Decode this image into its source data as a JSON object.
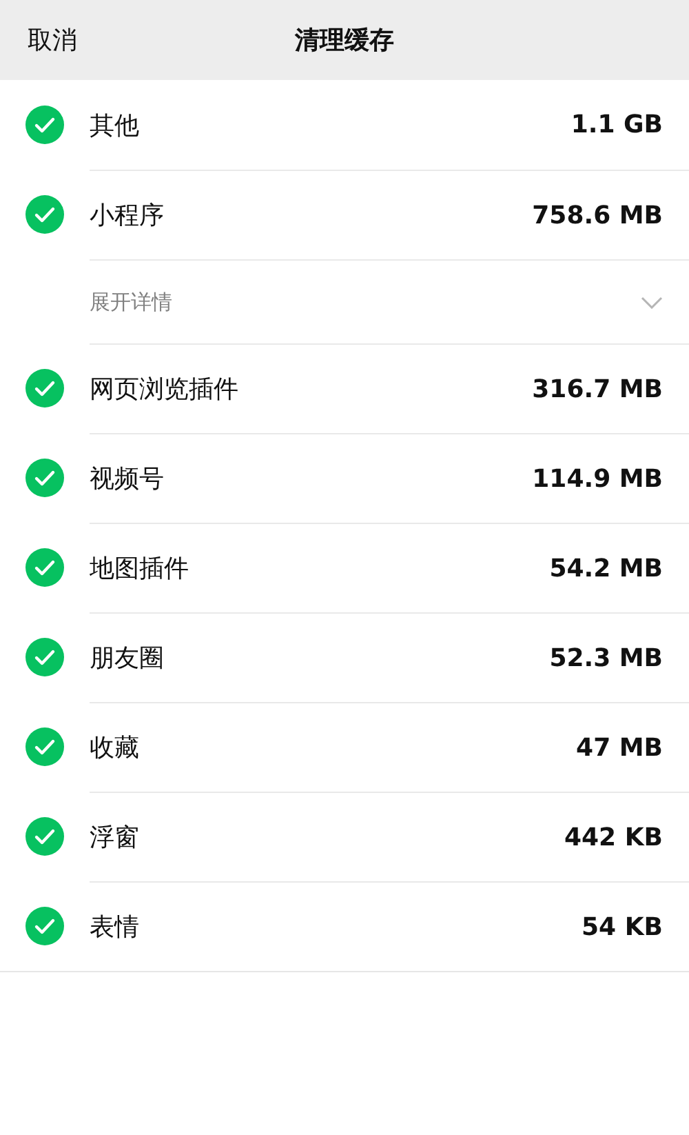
{
  "nav_bar": {
    "cancel": "取消",
    "title": "清理缓存"
  },
  "items": [
    {
      "kind": "item",
      "name": "其他",
      "size": "1.1 GB",
      "checked": true
    },
    {
      "kind": "item",
      "name": "小程序",
      "size": "758.6 MB",
      "checked": true
    },
    {
      "kind": "expand",
      "name": "展开详情",
      "expanded": false
    },
    {
      "kind": "item",
      "name": "网页浏览插件",
      "size": "316.7 MB",
      "checked": true
    },
    {
      "kind": "item",
      "name": "视频号",
      "size": "114.9 MB",
      "checked": true
    },
    {
      "kind": "item",
      "name": "地图插件",
      "size": "54.2 MB",
      "checked": true
    },
    {
      "kind": "item",
      "name": "朋友圈",
      "size": "52.3 MB",
      "checked": true
    },
    {
      "kind": "item",
      "name": "收藏",
      "size": "47 MB",
      "checked": true
    },
    {
      "kind": "item",
      "name": "浮窗",
      "size": "442 KB",
      "checked": true
    },
    {
      "kind": "item",
      "name": "表情",
      "size": "54 KB",
      "checked": true
    }
  ]
}
